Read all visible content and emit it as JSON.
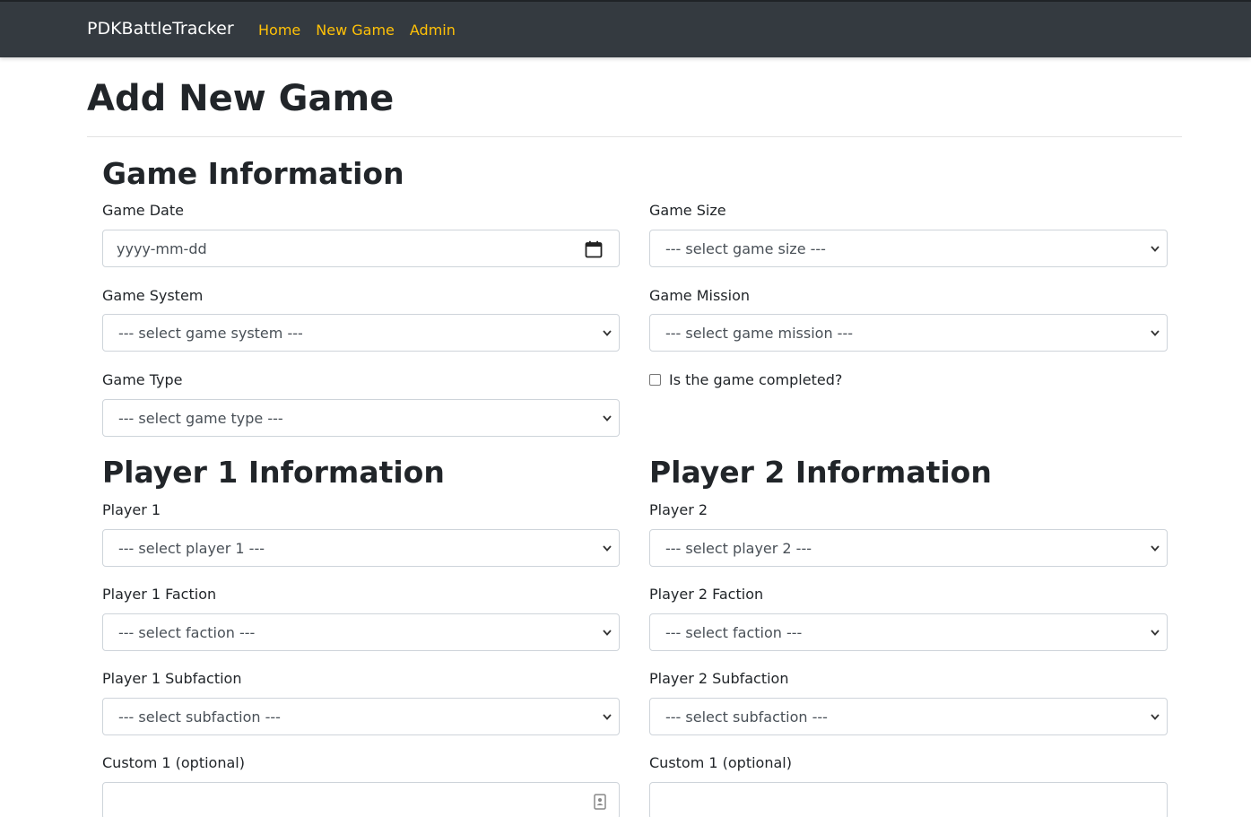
{
  "navbar": {
    "brand": "PDKBattleTracker",
    "links": [
      "Home",
      "New Game",
      "Admin"
    ]
  },
  "page": {
    "title": "Add New Game"
  },
  "game_info": {
    "heading": "Game Information",
    "game_date": {
      "label": "Game Date",
      "placeholder": "yyyy-mm-dd"
    },
    "game_size": {
      "label": "Game Size",
      "value": "--- select game size ---"
    },
    "game_system": {
      "label": "Game System",
      "value": "--- select game system ---"
    },
    "game_mission": {
      "label": "Game Mission",
      "value": "--- select game mission ---"
    },
    "game_type": {
      "label": "Game Type",
      "value": "--- select game type ---"
    },
    "completed": {
      "label": "Is the game completed?",
      "checked": false
    }
  },
  "player1": {
    "heading": "Player 1 Information",
    "player": {
      "label": "Player 1",
      "value": "--- select player 1 ---"
    },
    "faction": {
      "label": "Player 1 Faction",
      "value": "--- select faction ---"
    },
    "subfaction": {
      "label": "Player 1 Subfaction",
      "value": "--- select subfaction ---"
    },
    "custom": {
      "label": "Custom 1 (optional)",
      "value": ""
    }
  },
  "player2": {
    "heading": "Player 2 Information",
    "player": {
      "label": "Player 2",
      "value": "--- select player 2 ---"
    },
    "faction": {
      "label": "Player 2 Faction",
      "value": "--- select faction ---"
    },
    "subfaction": {
      "label": "Player 2 Subfaction",
      "value": "--- select subfaction ---"
    },
    "custom": {
      "label": "Custom 1 (optional)",
      "value": ""
    }
  },
  "colors": {
    "navbar_bg": "#343a40",
    "nav_link": "#ffc107",
    "text": "#212529",
    "input_border": "#ced4da"
  },
  "icons": [
    "calendar-icon",
    "chevron-down-icon",
    "contact-card-icon"
  ]
}
